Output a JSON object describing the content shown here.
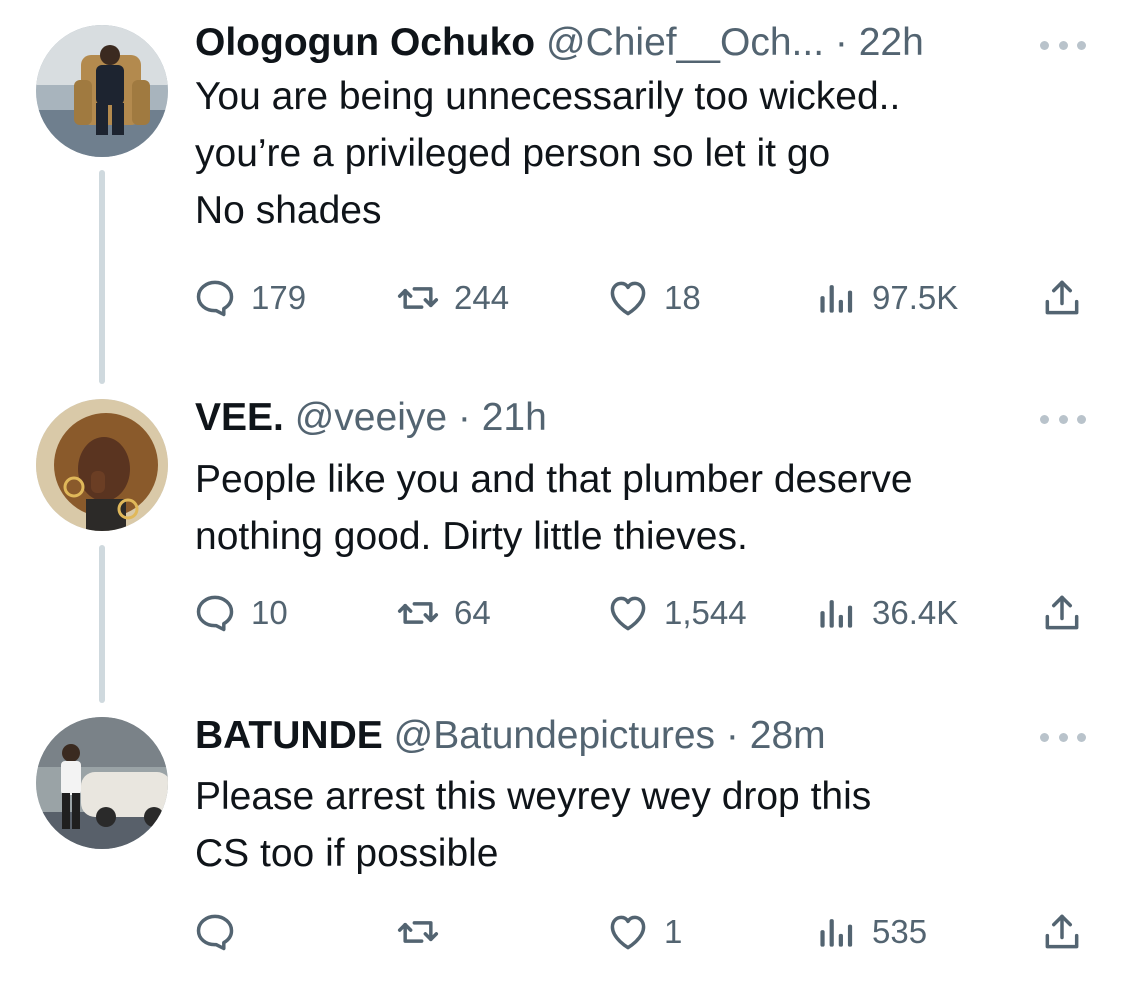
{
  "tweets": [
    {
      "name": "Ologogun Ochuko",
      "handle": "@Chief__Och...",
      "dot": "·",
      "time": "22h",
      "lines": [
        "You are being unnecessarily too wicked..",
        "you’re a privileged person so let it go",
        "No shades"
      ],
      "replies": "179",
      "retweets": "244",
      "likes": "18",
      "views": "97.5K"
    },
    {
      "name": "VEE.",
      "handle": "@veeiye",
      "dot": "·",
      "time": "21h",
      "lines": [
        "People like you and that plumber deserve",
        "nothing good. Dirty little thieves."
      ],
      "replies": "10",
      "retweets": "64",
      "likes": "1,544",
      "views": "36.4K"
    },
    {
      "name": "BATUNDE",
      "handle": "@Batundepictures",
      "dot": "·",
      "time": "28m",
      "lines": [
        "Please arrest this weyrey wey drop this",
        "CS too if possible"
      ],
      "replies": "",
      "retweets": "",
      "likes": "1",
      "views": "535"
    }
  ],
  "colors": {
    "text": "#0f1419",
    "secondary": "#536471",
    "thread_line": "#cfd9de",
    "more_dots": "#b9c3cb"
  },
  "icons": [
    "reply-icon",
    "retweet-icon",
    "like-icon",
    "views-icon",
    "share-icon",
    "more-icon"
  ]
}
